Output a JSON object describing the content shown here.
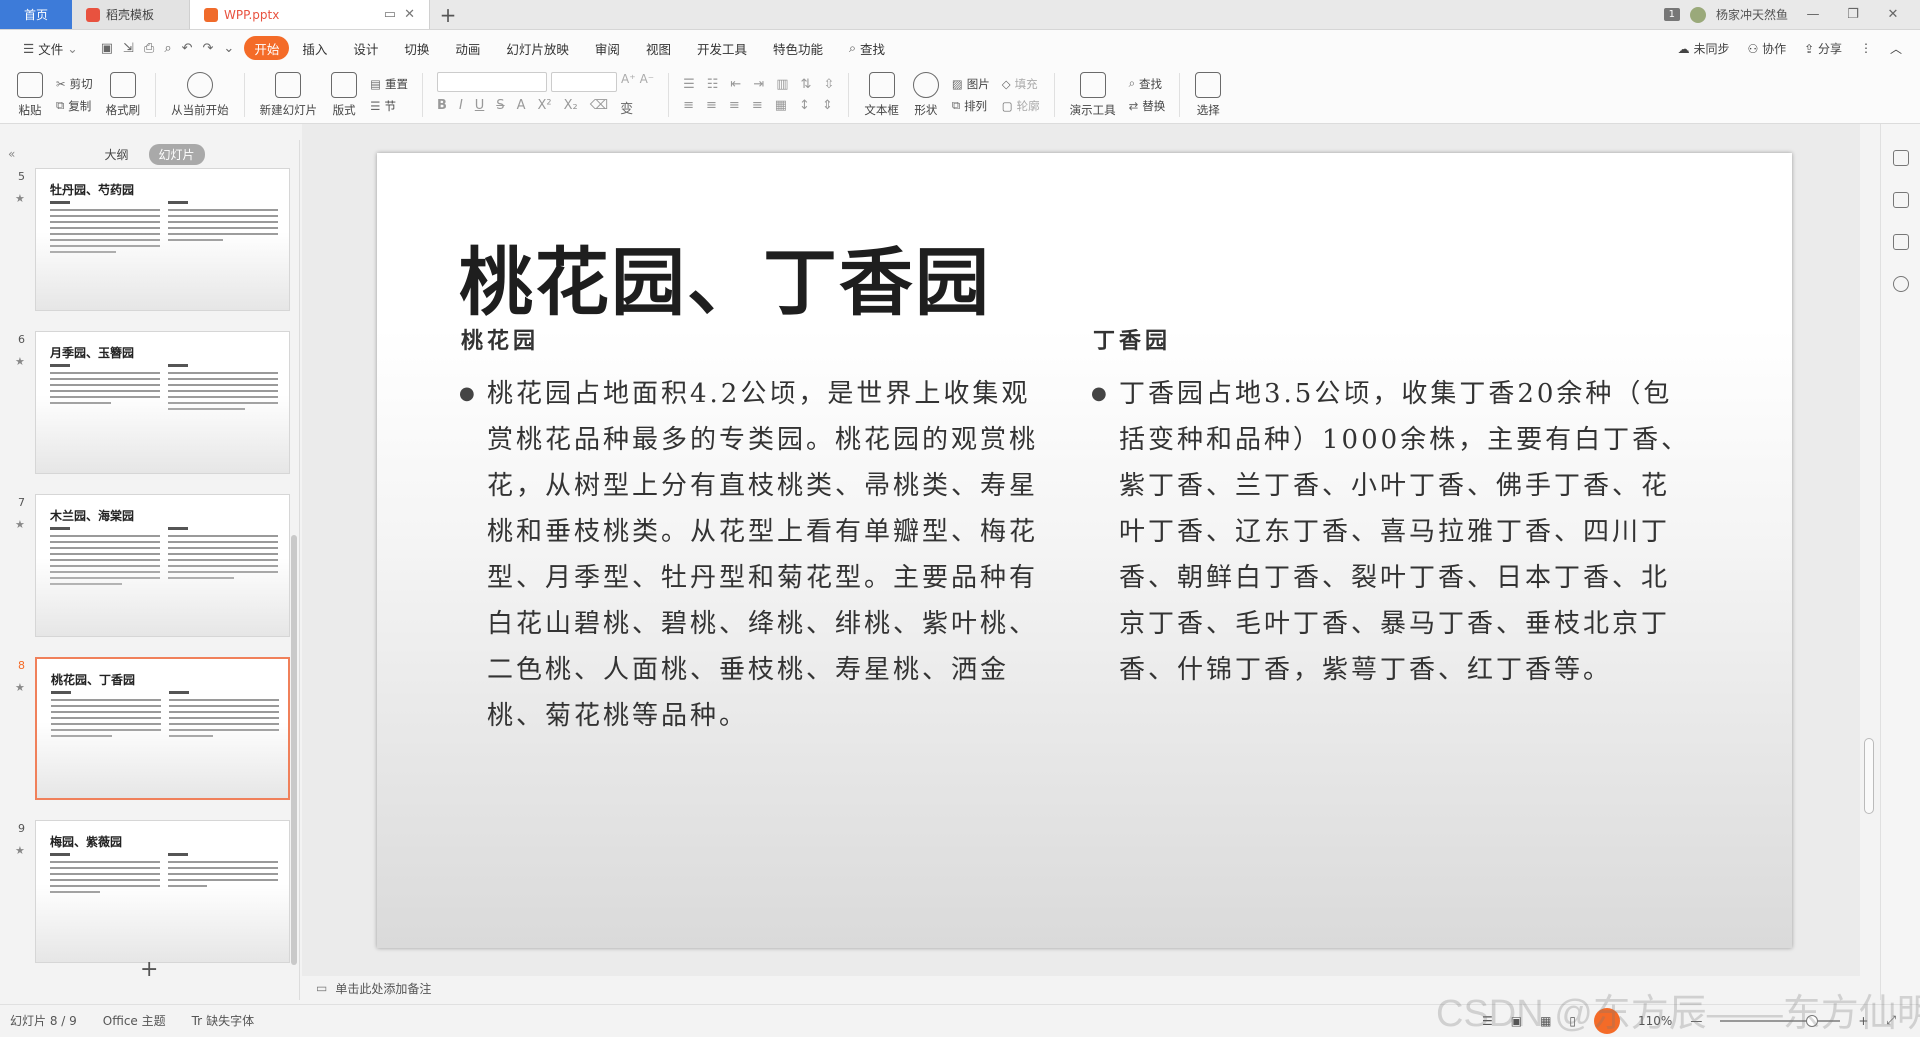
{
  "titlebar": {
    "tabs": [
      {
        "label": "首页"
      },
      {
        "label": "稻壳模板"
      },
      {
        "label": "WPP.pptx"
      }
    ],
    "page_badge": "1",
    "user": "杨家冲天然鱼"
  },
  "menu": {
    "file": "文件",
    "items": [
      "开始",
      "插入",
      "设计",
      "切换",
      "动画",
      "幻灯片放映",
      "审阅",
      "视图",
      "开发工具",
      "特色功能",
      "查找"
    ],
    "active": "开始",
    "right": [
      "未同步",
      "协作",
      "分享"
    ]
  },
  "ribbon": {
    "paste": "粘贴",
    "cut": "剪切",
    "copy": "复制",
    "format_painter": "格式刷",
    "from_current": "从当前开始",
    "new_slide": "新建幻灯片",
    "layout": "版式",
    "reset": "重置",
    "section": "节",
    "textbox": "文本框",
    "shape": "形状",
    "picture": "图片",
    "fill": "填充",
    "arrange": "排列",
    "outline": "轮廓",
    "present_tools": "演示工具",
    "find": "查找",
    "replace": "替换",
    "select": "选择",
    "bold": "B",
    "italic": "I",
    "underline": "U",
    "strike": "S",
    "fontcolor": "A"
  },
  "leftpanel": {
    "tabs": [
      "大纲",
      "幻灯片"
    ],
    "active_tab": "幻灯片",
    "slides": [
      {
        "num": "5",
        "title": "牡丹园、芍药园"
      },
      {
        "num": "6",
        "title": "月季园、玉簪园"
      },
      {
        "num": "7",
        "title": "木兰园、海棠园"
      },
      {
        "num": "8",
        "title": "桃花园、丁香园",
        "current": true
      },
      {
        "num": "9",
        "title": "梅园、紫薇园"
      }
    ]
  },
  "slide": {
    "title": "桃花园、丁香园",
    "left_heading": "桃花园",
    "left_body": "桃花园占地面积4.2公顷，是世界上收集观赏桃花品种最多的专类园。桃花园的观赏桃花，从树型上分有直枝桃类、帚桃类、寿星桃和垂枝桃类。从花型上看有单瓣型、梅花型、月季型、牡丹型和菊花型。主要品种有白花山碧桃、碧桃、绛桃、绯桃、紫叶桃、二色桃、人面桃、垂枝桃、寿星桃、洒金桃、菊花桃等品种。",
    "right_heading": "丁香园",
    "right_body": "丁香园占地3.5公顷，收集丁香20余种（包括变种和品种）1000余株，主要有白丁香、紫丁香、兰丁香、小叶丁香、佛手丁香、花叶丁香、辽东丁香、喜马拉雅丁香、四川丁香、朝鲜白丁香、裂叶丁香、日本丁香、北京丁香、毛叶丁香、暴马丁香、垂枝北京丁香、什锦丁香，紫萼丁香、红丁香等。"
  },
  "notes": {
    "placeholder": "单击此处添加备注"
  },
  "status": {
    "slide_count": "幻灯片 8 / 9",
    "theme": "Office 主题",
    "missing_font": "缺失字体",
    "zoom": "110%"
  },
  "watermark": "CSDN @东方辰——东方仙明"
}
